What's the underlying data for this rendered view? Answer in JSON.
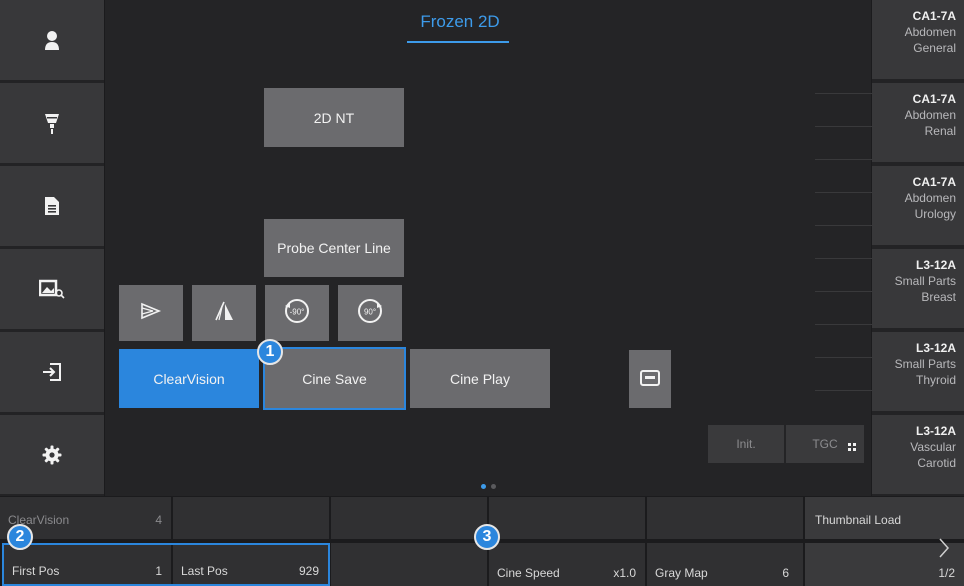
{
  "header": {
    "title": "Frozen 2D"
  },
  "sidebar": {
    "items": [
      {
        "name": "patient",
        "icon": "person-icon"
      },
      {
        "name": "probe",
        "icon": "probe-icon"
      },
      {
        "name": "report",
        "icon": "document-icon"
      },
      {
        "name": "review",
        "icon": "image-review-icon"
      },
      {
        "name": "exit",
        "icon": "exit-icon"
      },
      {
        "name": "settings",
        "icon": "gear-icon"
      }
    ]
  },
  "main": {
    "buttons": {
      "nt": "2D NT",
      "probe_center": "Probe Center Line",
      "clearvision": "ClearVision",
      "cine_save": "Cine Save",
      "cine_play": "Cine Play"
    },
    "icon_buttons": [
      {
        "name": "flip-horizontal-icon"
      },
      {
        "name": "flip-vertical-icon"
      },
      {
        "name": "rotate-left-90-icon",
        "text": "-90°"
      },
      {
        "name": "rotate-right-90-icon",
        "text": "90°"
      }
    ],
    "markers": {
      "one": "1",
      "two": "2",
      "three": "3"
    },
    "tgc": {
      "init_label": "Init.",
      "tgc_label": "TGC",
      "sliders": 10
    },
    "page_indicator": {
      "current": 1,
      "total": 2
    }
  },
  "presets": [
    {
      "probe": "CA1-7A",
      "line2": "Abdomen",
      "line3": "General"
    },
    {
      "probe": "CA1-7A",
      "line2": "Abdomen",
      "line3": "Renal"
    },
    {
      "probe": "CA1-7A",
      "line2": "Abdomen",
      "line3": "Urology"
    },
    {
      "probe": "L3-12A",
      "line2": "Small Parts",
      "line3": "Breast"
    },
    {
      "probe": "L3-12A",
      "line2": "Small Parts",
      "line3": "Thyroid"
    },
    {
      "probe": "L3-12A",
      "line2": "Vascular",
      "line3": "Carotid"
    }
  ],
  "bottom": {
    "top_row": {
      "clearvision_label": "ClearVision",
      "clearvision_value": "4",
      "thumbnail_label": "Thumbnail Load"
    },
    "bottom_row": {
      "first_pos_label": "First Pos",
      "first_pos_value": "1",
      "last_pos_label": "Last Pos",
      "last_pos_value": "929",
      "cine_speed_label": "Cine Speed",
      "cine_speed_value": "x1.0",
      "gray_map_label": "Gray Map",
      "gray_map_value": "6",
      "page_label": "1/2"
    }
  },
  "colors": {
    "accent": "#2b86dd",
    "title": "#3d9bea",
    "button": "#6b6b6e",
    "panel": "#38383a"
  }
}
